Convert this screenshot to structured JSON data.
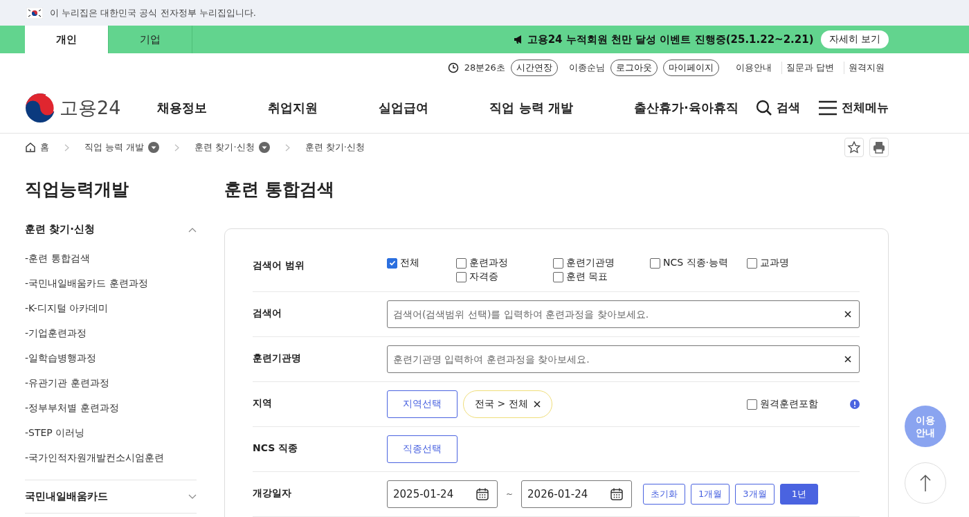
{
  "gov_banner": {
    "text": "이 누리집은 대한민국 공식 전자정부 누리집입니다."
  },
  "user_tabs": [
    {
      "label": "개인",
      "selected": true
    },
    {
      "label": "기업",
      "selected": false
    }
  ],
  "notice": {
    "text": "고용24 누적회원 천만 달성 이벤트 진행중(25.1.22~2.21)",
    "button": "자세히 보기"
  },
  "utility": {
    "timer": "28분26초",
    "extend_button": "시간연장",
    "user": "이종순님",
    "logout_button": "로그아웃",
    "mypage_button": "마이페이지",
    "links": [
      "이용안내",
      "질문과 답변",
      "원격지원"
    ]
  },
  "header": {
    "logo": "고용24",
    "nav": [
      "채용정보",
      "취업지원",
      "실업급여",
      "직업 능력 개발",
      "출산휴가·육아휴직"
    ],
    "search": "검색",
    "menu": "전체메뉴"
  },
  "breadcrumb": [
    {
      "label": "홈",
      "kind": "home"
    },
    {
      "label": "직업 능력 개발",
      "kind": "dropdown"
    },
    {
      "label": "훈련 찾기·신청",
      "kind": "dropdown"
    },
    {
      "label": "훈련 찾기·신청",
      "kind": "current"
    }
  ],
  "sidebar": {
    "title": "직업능력개발",
    "sections": [
      {
        "label": "훈련 찾기·신청",
        "expanded": true,
        "items": [
          "-훈련 통합검색",
          "-국민내일배움카드 훈련과정",
          "-K-디지털 아카데미",
          "-기업훈련과정",
          "-일학습병행과정",
          "-유관기관 훈련과정",
          "-정부부처별 훈련과정",
          "-STEP 이러닝",
          "-국가인적자원개발컨소시엄훈련"
        ]
      },
      {
        "label": "국민내일배움카드",
        "expanded": false
      }
    ]
  },
  "page_title": "훈련 통합검색",
  "form": {
    "rows": [
      {
        "kind": "checkboxes",
        "label": "검색어 범위",
        "options": [
          {
            "label": "전체",
            "checked": true
          },
          {
            "label": "훈련과정",
            "checked": false
          },
          {
            "label": "훈련기관명",
            "checked": false
          },
          {
            "label": "NCS 직종·능력",
            "checked": false
          },
          {
            "label": "교과명",
            "checked": false
          },
          {
            "label": "자격증",
            "checked": false
          },
          {
            "label": "훈련 목표",
            "checked": false
          }
        ]
      },
      {
        "kind": "text",
        "label": "검색어",
        "placeholder": "검색어(검색범위 선택)를 입력하여 훈련과정을 찾아보세요."
      },
      {
        "kind": "text",
        "label": "훈련기관명",
        "placeholder": "훈련기관명 입력하여 훈련과정을 찾아보세요."
      },
      {
        "kind": "region",
        "label": "지역",
        "button": "지역선택",
        "chip": "전국 > 전체",
        "remote": {
          "label": "원격훈련포함",
          "checked": false
        }
      },
      {
        "kind": "select",
        "label": "NCS 직종",
        "button": "직종선택"
      },
      {
        "kind": "dates",
        "label": "개강일자",
        "start": "2025-01-24",
        "separator": "~",
        "end": "2026-01-24",
        "periods": [
          {
            "label": "초기화",
            "selected": false
          },
          {
            "label": "1개월",
            "selected": false
          },
          {
            "label": "3개월",
            "selected": false
          },
          {
            "label": "1년",
            "selected": true
          }
        ]
      }
    ]
  },
  "floating": {
    "guide": "이용 안내"
  }
}
